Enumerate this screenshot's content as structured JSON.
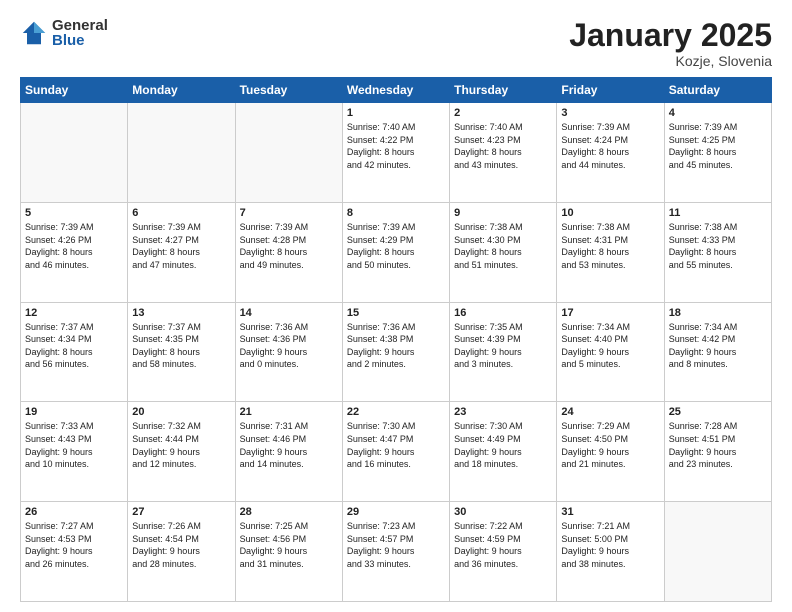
{
  "header": {
    "logo_general": "General",
    "logo_blue": "Blue",
    "title": "January 2025",
    "subtitle": "Kozje, Slovenia"
  },
  "weekdays": [
    "Sunday",
    "Monday",
    "Tuesday",
    "Wednesday",
    "Thursday",
    "Friday",
    "Saturday"
  ],
  "weeks": [
    [
      {
        "day": "",
        "content": ""
      },
      {
        "day": "",
        "content": ""
      },
      {
        "day": "",
        "content": ""
      },
      {
        "day": "1",
        "content": "Sunrise: 7:40 AM\nSunset: 4:22 PM\nDaylight: 8 hours\nand 42 minutes."
      },
      {
        "day": "2",
        "content": "Sunrise: 7:40 AM\nSunset: 4:23 PM\nDaylight: 8 hours\nand 43 minutes."
      },
      {
        "day": "3",
        "content": "Sunrise: 7:39 AM\nSunset: 4:24 PM\nDaylight: 8 hours\nand 44 minutes."
      },
      {
        "day": "4",
        "content": "Sunrise: 7:39 AM\nSunset: 4:25 PM\nDaylight: 8 hours\nand 45 minutes."
      }
    ],
    [
      {
        "day": "5",
        "content": "Sunrise: 7:39 AM\nSunset: 4:26 PM\nDaylight: 8 hours\nand 46 minutes."
      },
      {
        "day": "6",
        "content": "Sunrise: 7:39 AM\nSunset: 4:27 PM\nDaylight: 8 hours\nand 47 minutes."
      },
      {
        "day": "7",
        "content": "Sunrise: 7:39 AM\nSunset: 4:28 PM\nDaylight: 8 hours\nand 49 minutes."
      },
      {
        "day": "8",
        "content": "Sunrise: 7:39 AM\nSunset: 4:29 PM\nDaylight: 8 hours\nand 50 minutes."
      },
      {
        "day": "9",
        "content": "Sunrise: 7:38 AM\nSunset: 4:30 PM\nDaylight: 8 hours\nand 51 minutes."
      },
      {
        "day": "10",
        "content": "Sunrise: 7:38 AM\nSunset: 4:31 PM\nDaylight: 8 hours\nand 53 minutes."
      },
      {
        "day": "11",
        "content": "Sunrise: 7:38 AM\nSunset: 4:33 PM\nDaylight: 8 hours\nand 55 minutes."
      }
    ],
    [
      {
        "day": "12",
        "content": "Sunrise: 7:37 AM\nSunset: 4:34 PM\nDaylight: 8 hours\nand 56 minutes."
      },
      {
        "day": "13",
        "content": "Sunrise: 7:37 AM\nSunset: 4:35 PM\nDaylight: 8 hours\nand 58 minutes."
      },
      {
        "day": "14",
        "content": "Sunrise: 7:36 AM\nSunset: 4:36 PM\nDaylight: 9 hours\nand 0 minutes."
      },
      {
        "day": "15",
        "content": "Sunrise: 7:36 AM\nSunset: 4:38 PM\nDaylight: 9 hours\nand 2 minutes."
      },
      {
        "day": "16",
        "content": "Sunrise: 7:35 AM\nSunset: 4:39 PM\nDaylight: 9 hours\nand 3 minutes."
      },
      {
        "day": "17",
        "content": "Sunrise: 7:34 AM\nSunset: 4:40 PM\nDaylight: 9 hours\nand 5 minutes."
      },
      {
        "day": "18",
        "content": "Sunrise: 7:34 AM\nSunset: 4:42 PM\nDaylight: 9 hours\nand 8 minutes."
      }
    ],
    [
      {
        "day": "19",
        "content": "Sunrise: 7:33 AM\nSunset: 4:43 PM\nDaylight: 9 hours\nand 10 minutes."
      },
      {
        "day": "20",
        "content": "Sunrise: 7:32 AM\nSunset: 4:44 PM\nDaylight: 9 hours\nand 12 minutes."
      },
      {
        "day": "21",
        "content": "Sunrise: 7:31 AM\nSunset: 4:46 PM\nDaylight: 9 hours\nand 14 minutes."
      },
      {
        "day": "22",
        "content": "Sunrise: 7:30 AM\nSunset: 4:47 PM\nDaylight: 9 hours\nand 16 minutes."
      },
      {
        "day": "23",
        "content": "Sunrise: 7:30 AM\nSunset: 4:49 PM\nDaylight: 9 hours\nand 18 minutes."
      },
      {
        "day": "24",
        "content": "Sunrise: 7:29 AM\nSunset: 4:50 PM\nDaylight: 9 hours\nand 21 minutes."
      },
      {
        "day": "25",
        "content": "Sunrise: 7:28 AM\nSunset: 4:51 PM\nDaylight: 9 hours\nand 23 minutes."
      }
    ],
    [
      {
        "day": "26",
        "content": "Sunrise: 7:27 AM\nSunset: 4:53 PM\nDaylight: 9 hours\nand 26 minutes."
      },
      {
        "day": "27",
        "content": "Sunrise: 7:26 AM\nSunset: 4:54 PM\nDaylight: 9 hours\nand 28 minutes."
      },
      {
        "day": "28",
        "content": "Sunrise: 7:25 AM\nSunset: 4:56 PM\nDaylight: 9 hours\nand 31 minutes."
      },
      {
        "day": "29",
        "content": "Sunrise: 7:23 AM\nSunset: 4:57 PM\nDaylight: 9 hours\nand 33 minutes."
      },
      {
        "day": "30",
        "content": "Sunrise: 7:22 AM\nSunset: 4:59 PM\nDaylight: 9 hours\nand 36 minutes."
      },
      {
        "day": "31",
        "content": "Sunrise: 7:21 AM\nSunset: 5:00 PM\nDaylight: 9 hours\nand 38 minutes."
      },
      {
        "day": "",
        "content": ""
      }
    ]
  ]
}
